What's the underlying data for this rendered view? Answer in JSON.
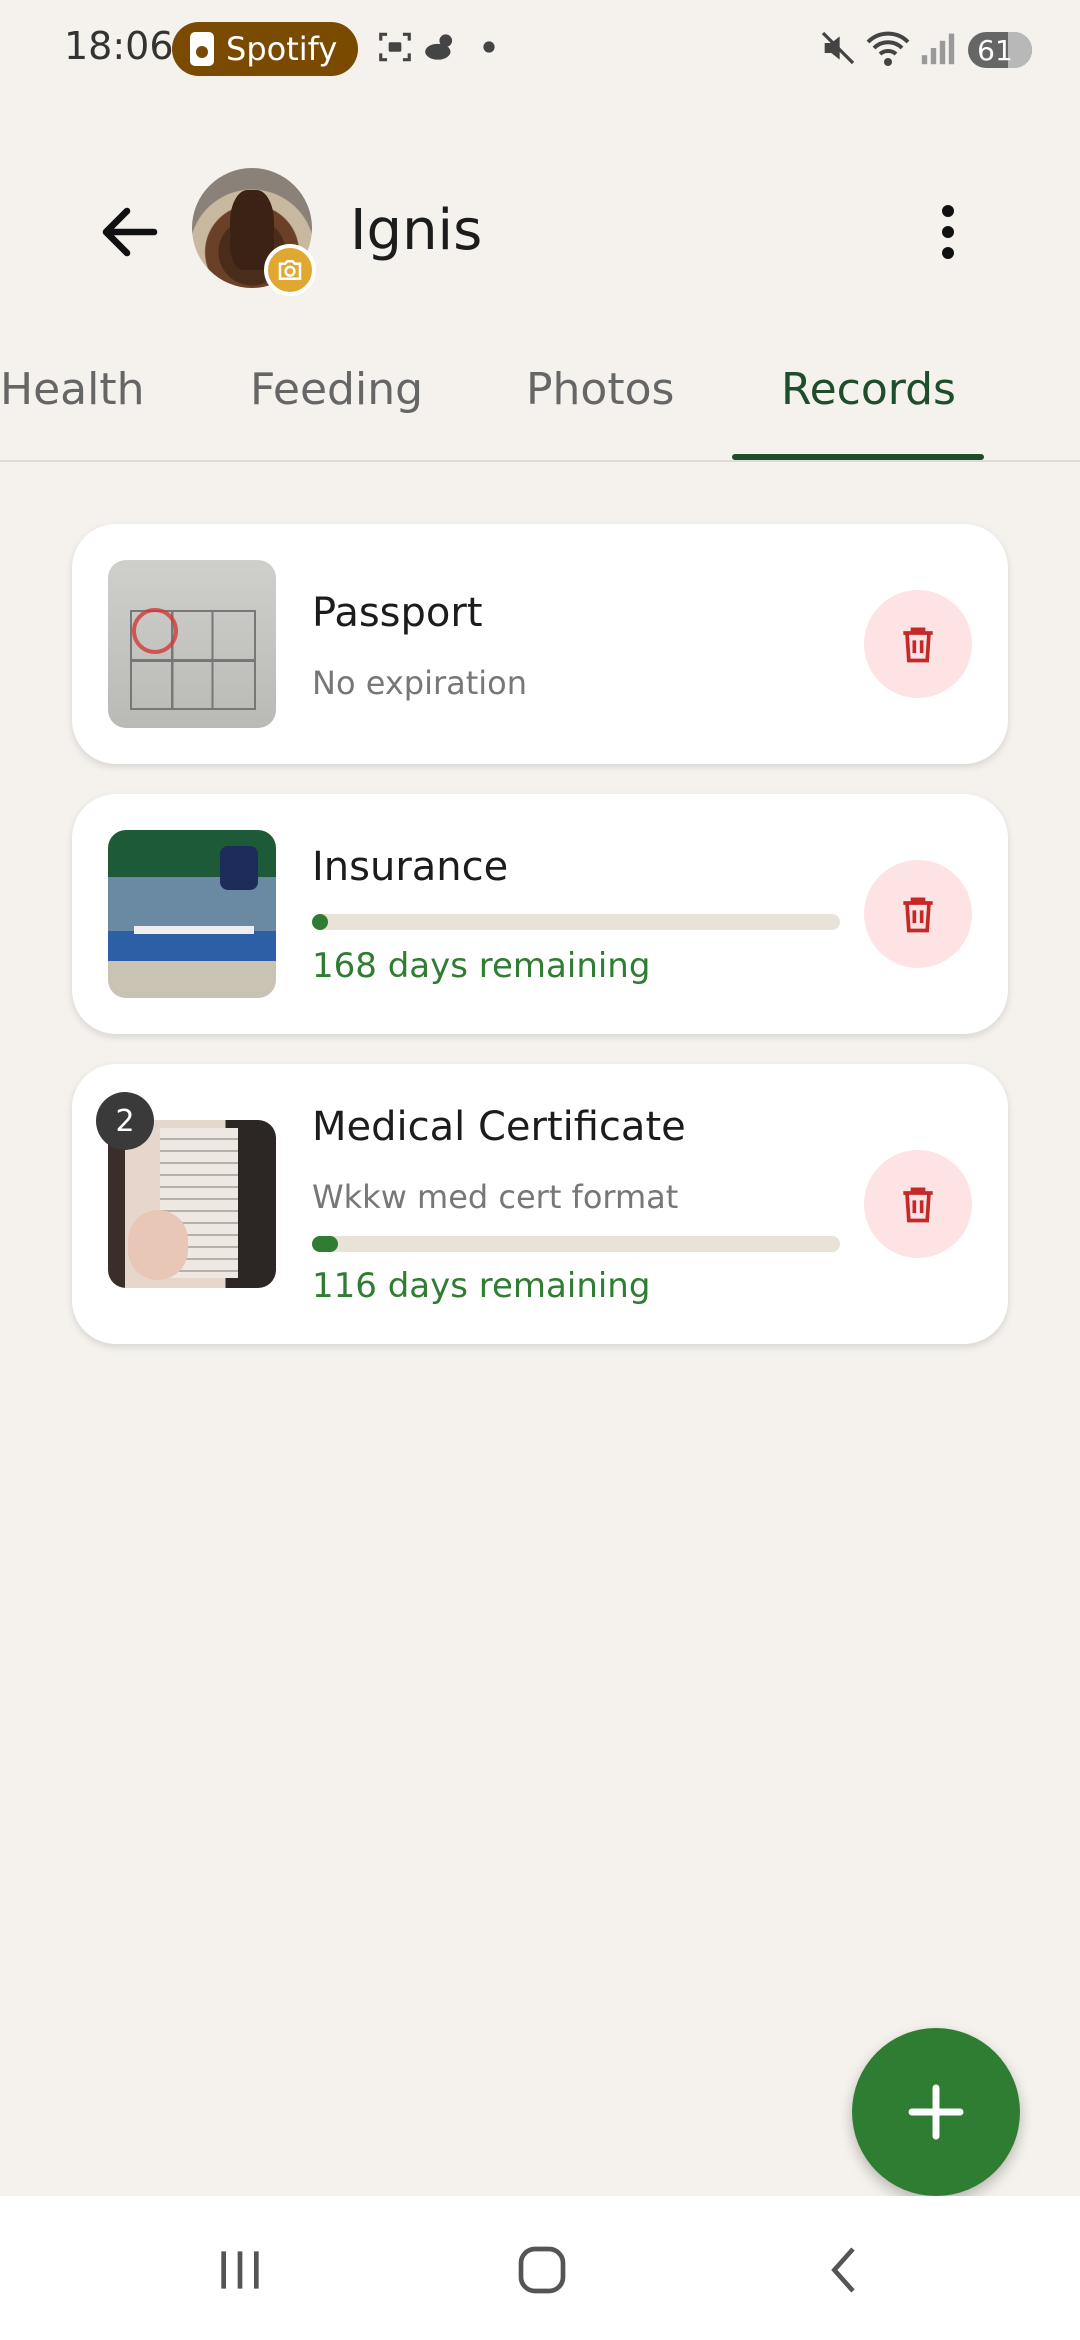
{
  "status_bar": {
    "time": "18:06",
    "media_app": "Spotify",
    "battery": "61"
  },
  "header": {
    "name": "Ignis"
  },
  "tabs": [
    {
      "label": "Health",
      "active": false
    },
    {
      "label": "Feeding",
      "active": false
    },
    {
      "label": "Photos",
      "active": false
    },
    {
      "label": "Records",
      "active": true
    }
  ],
  "records": [
    {
      "title": "Passport",
      "subtitle": "No expiration"
    },
    {
      "title": "Insurance",
      "remaining": "168 days remaining",
      "progress": 0.03
    },
    {
      "title": "Medical Certificate",
      "subtitle": "Wkkw med cert format",
      "remaining": "116 days remaining",
      "progress": 0.05,
      "photo_count": "2"
    }
  ],
  "colors": {
    "accent": "#2e7d32",
    "tab_active": "#1d4d2a",
    "delete_bg": "#fde3e4",
    "delete_icon": "#c62828",
    "background": "#f5f2ed"
  },
  "icons": {
    "back": "arrow-back-icon",
    "more": "more-vert-icon",
    "delete": "trash-icon",
    "add": "plus-icon",
    "camera": "camera-icon"
  }
}
